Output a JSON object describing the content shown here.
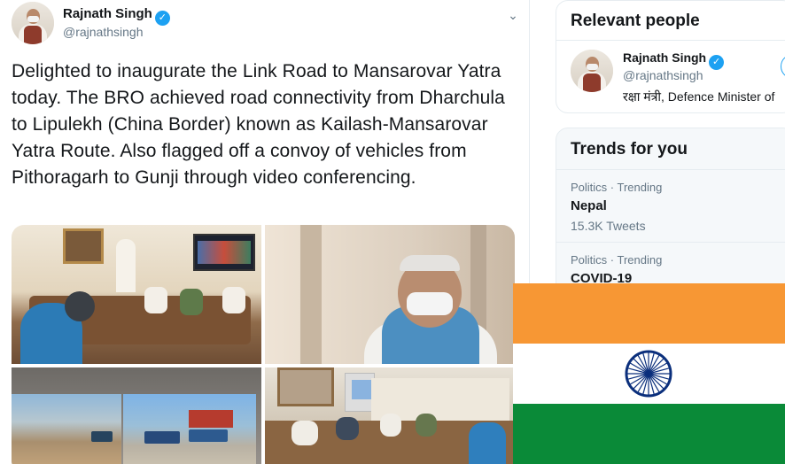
{
  "tweet": {
    "author_name": "Rajnath Singh",
    "author_handle": "@rajnathsingh",
    "verified_glyph": "✓",
    "menu_glyph": "⌄",
    "text": "Delighted to inaugurate the Link Road  to Mansarovar Yatra today. The BRO achieved road connectivity from Dharchula to Lipulekh (China Border) known as Kailash-Mansarovar Yatra Route.  Also flagged off a convoy of vehicles from Pithoragarh to Gunji through video conferencing.",
    "media_count": 4
  },
  "relevant_people": {
    "title": "Relevant people",
    "person": {
      "name": "Rajnath Singh",
      "handle": "@rajnathsingh",
      "bio": "रक्षा मंत्री, Defence Minister of"
    }
  },
  "trends": {
    "title": "Trends for you",
    "items": [
      {
        "meta": "Politics · Trending",
        "name": "Nepal",
        "count": "15.3K Tweets"
      },
      {
        "meta": "Politics · Trending",
        "name": "COVID-19",
        "count": ""
      }
    ]
  },
  "colors": {
    "saffron": "#f79734",
    "white": "#ffffff",
    "green": "#0a8a38",
    "chakra": "#0b2f7c",
    "verified": "#1da1f2"
  }
}
